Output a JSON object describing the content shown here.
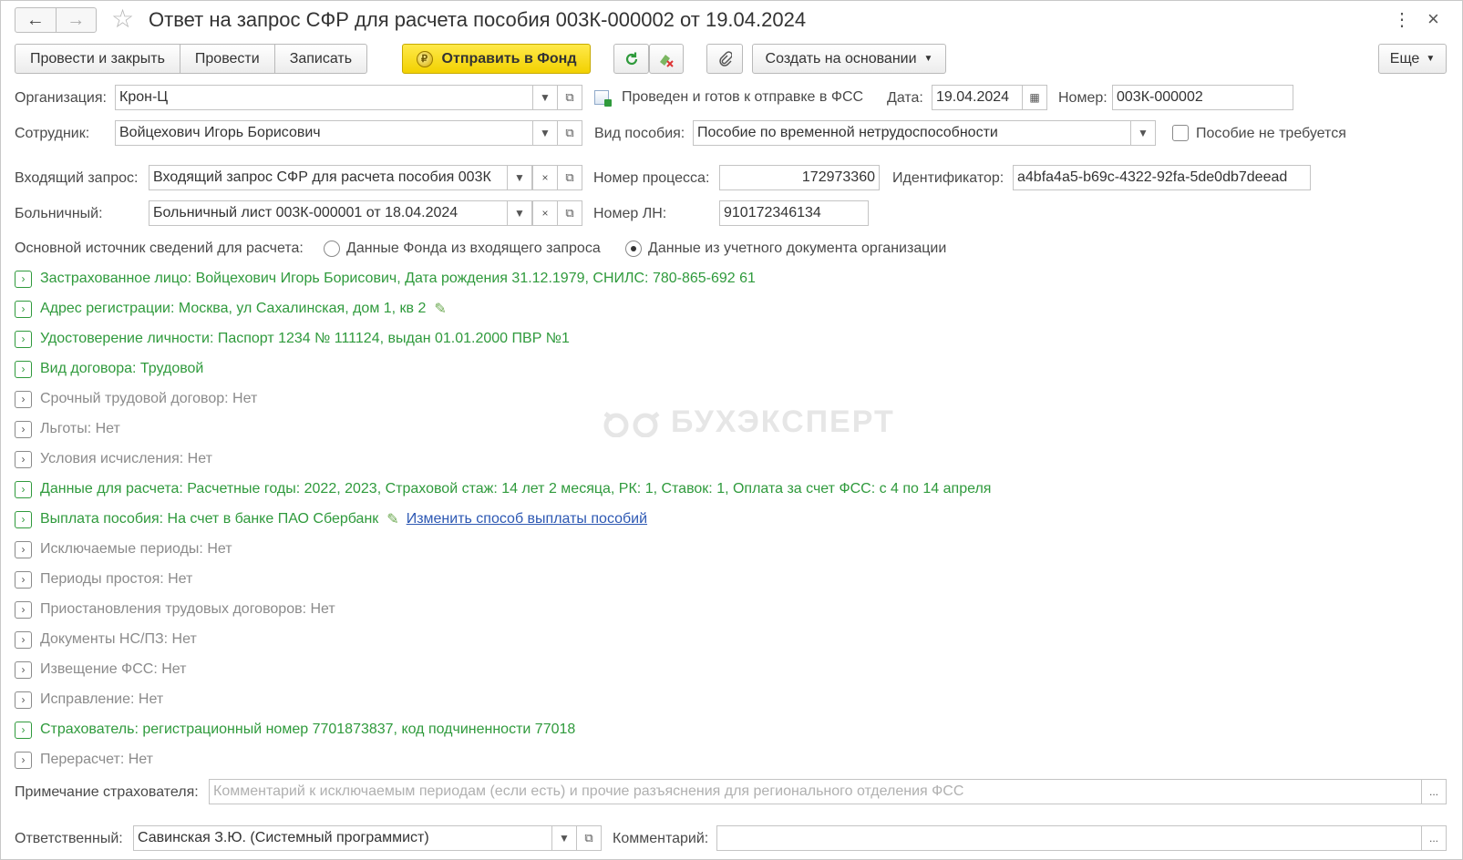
{
  "window": {
    "title": "Ответ на запрос СФР для расчета пособия 003К-000002 от 19.04.2024"
  },
  "toolbar": {
    "post_close": "Провести и закрыть",
    "post": "Провести",
    "save": "Записать",
    "send_fund": "Отправить в Фонд",
    "create_basis": "Создать на основании",
    "more": "Еще"
  },
  "form": {
    "org_label": "Организация:",
    "org_value": "Крон-Ц",
    "status_text": "Проведен и готов к отправке в ФСС",
    "date_label": "Дата:",
    "date_value": "19.04.2024",
    "number_label": "Номер:",
    "number_value": "003К-000002",
    "employee_label": "Сотрудник:",
    "employee_value": "Войцехович Игорь Борисович",
    "benefit_type_label": "Вид пособия:",
    "benefit_type_value": "Пособие по временной нетрудоспособности",
    "not_required_label": "Пособие не требуется",
    "incoming_label": "Входящий запрос:",
    "incoming_value": "Входящий запрос СФР для расчета пособия 003К",
    "process_label": "Номер процесса:",
    "process_value": "172973360",
    "identifier_label": "Идентификатор:",
    "identifier_value": "a4bfa4a5-b69c-4322-92fa-5de0db7deead",
    "sick_label": "Больничный:",
    "sick_value": "Больничный лист 003К-000001 от 18.04.2024",
    "ln_label": "Номер ЛН:",
    "ln_value": "910172346134",
    "source_label": "Основной источник сведений для расчета:",
    "source_option1": "Данные Фонда из входящего запроса",
    "source_option2": "Данные из учетного документа организации",
    "note_label": "Примечание страхователя:",
    "note_placeholder": "Комментарий к исключаемым периодам (если есть) и прочие разъяснения для регионального отделения ФСС",
    "responsible_label": "Ответственный:",
    "responsible_value": "Савинская З.Ю. (Системный программист)",
    "comment_label": "Комментарий:",
    "ellipsis": "..."
  },
  "sections": [
    {
      "text": "Застрахованное лицо: Войцехович Игорь Борисович, Дата рождения 31.12.1979, СНИЛС: 780-865-692 61",
      "state": "green"
    },
    {
      "text": "Адрес регистрации: Москва, ул Сахалинская, дом 1, кв 2",
      "state": "green"
    },
    {
      "text": "Удостоверение личности: Паспорт 1234 № 111124, выдан 01.01.2000 ПВР №1",
      "state": "green"
    },
    {
      "text": "Вид договора: Трудовой",
      "state": "green"
    },
    {
      "text": "Срочный трудовой договор: Нет",
      "state": "gray"
    },
    {
      "text": "Льготы: Нет",
      "state": "gray"
    },
    {
      "text": "Условия исчисления: Нет",
      "state": "gray"
    },
    {
      "text": "Данные для расчета: Расчетные годы: 2022, 2023, Страховой стаж: 14 лет 2 месяца, РК: 1, Ставок: 1, Оплата за счет ФСС: с 4 по 14 апреля",
      "state": "green"
    },
    {
      "text": "Выплата пособия: На счет в банке ПАО Сбербанк",
      "state": "green",
      "link": "Изменить способ выплаты пособий"
    },
    {
      "text": "Исключаемые периоды: Нет",
      "state": "gray"
    },
    {
      "text": "Периоды простоя: Нет",
      "state": "gray"
    },
    {
      "text": "Приостановления трудовых договоров: Нет",
      "state": "gray"
    },
    {
      "text": "Документы НС/ПЗ: Нет",
      "state": "gray"
    },
    {
      "text": "Извещение ФСС: Нет",
      "state": "gray"
    },
    {
      "text": "Исправление: Нет",
      "state": "gray"
    },
    {
      "text": "Страхователь: регистрационный номер 7701873837, код подчиненности 77018",
      "state": "green"
    },
    {
      "text": "Перерасчет: Нет",
      "state": "gray"
    }
  ],
  "watermark": "БУХЭКСПЕРТ",
  "icons": {
    "back": "arrow-left-icon",
    "forward": "arrow-right-icon",
    "favorite": "star-icon",
    "menu": "kebab-icon",
    "close": "close-icon",
    "refresh": "refresh-icon",
    "cancel_post": "cancel-post-icon",
    "attach": "paperclip-icon"
  },
  "colors": {
    "accent_yellow": "#f2d100",
    "green_text": "#2f9a3c",
    "gray_text": "#8b8b8b",
    "link": "#2d58b3"
  }
}
